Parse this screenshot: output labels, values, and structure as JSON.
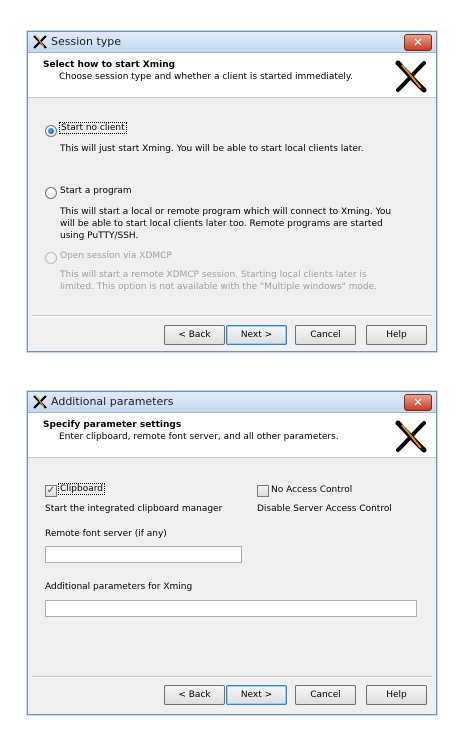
{
  "dialog1": {
    "title": "Session type",
    "header_title": "Select how to start Xming",
    "header_subtitle": "Choose session type and whether a client is started immediately.",
    "options": [
      {
        "label": "Start no client",
        "selected": true,
        "enabled": true,
        "description": "This will just start Xming. You will be able to start local clients later."
      },
      {
        "label": "Start a program",
        "selected": false,
        "enabled": true,
        "description": "This will start a local or remote program which will connect to Xming. You will be able to start local clients later too. Remote programs are started using PuTTY/SSH."
      },
      {
        "label": "Open session via XDMCP",
        "selected": false,
        "enabled": false,
        "description": "This will start a remote XDMCP session. Starting local clients later is limited. This option is not available with the \"Multiple windows\" mode."
      }
    ]
  },
  "dialog2": {
    "title": "Additional parameters",
    "header_title": "Specify parameter settings",
    "header_subtitle": "Enter clipboard, remote font server, and all other parameters.",
    "clipboard": {
      "label": "Clipboard",
      "checked": true,
      "description": "Start the integrated clipboard manager"
    },
    "no_access_control": {
      "label": "No Access Control",
      "checked": false,
      "description": "Disable Server Access Control"
    },
    "font_server": {
      "label": "Remote font server (if any)",
      "value": ""
    },
    "extra_params": {
      "label": "Additional parameters for Xming",
      "value": ""
    }
  },
  "buttons": {
    "back_label": "< Back",
    "next_label": "Next >",
    "cancel_label": "Cancel",
    "help_label": "Help"
  },
  "close_glyph": "✕",
  "checkmark_glyph": "✓",
  "colors": {
    "logo_black": "#000000",
    "logo_orange": "#f28a1a",
    "close_red": "#c43e26"
  }
}
